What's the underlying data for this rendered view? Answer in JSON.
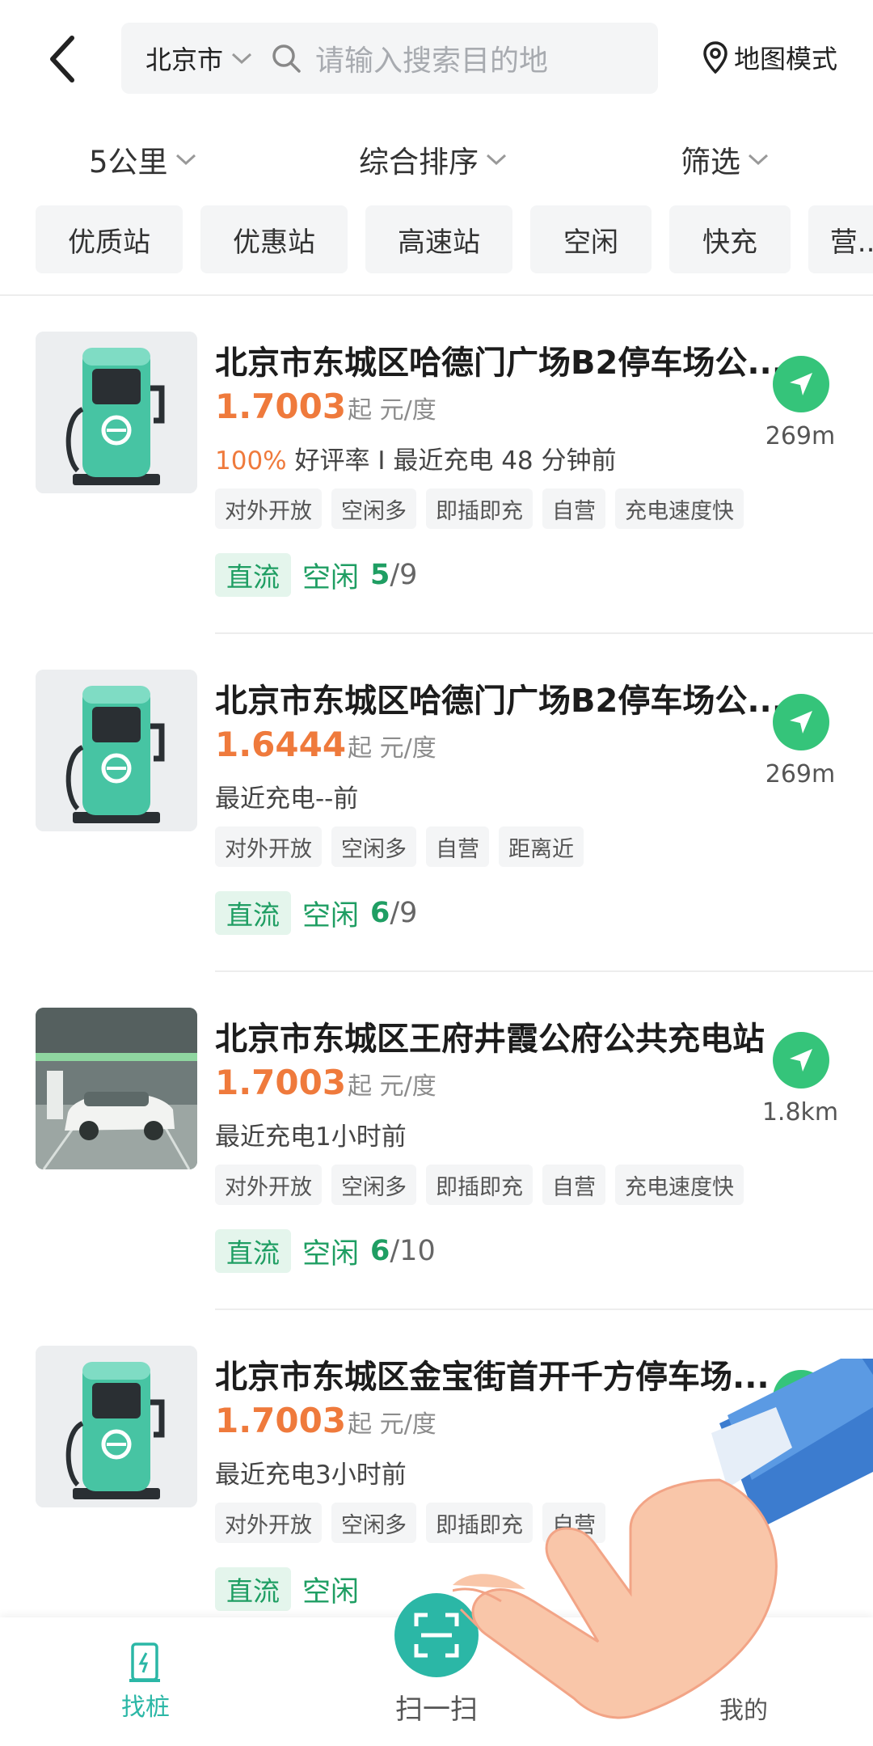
{
  "header": {
    "city": "北京市",
    "search_placeholder": "请输入搜索目的地",
    "map_mode": "地图模式"
  },
  "sortbar": {
    "distance": "5公里",
    "sort": "综合排序",
    "filter": "筛选"
  },
  "chips": [
    "优质站",
    "优惠站",
    "高速站",
    "空闲",
    "快充",
    "营..."
  ],
  "stations": [
    {
      "title": "北京市东城区哈德门广场B2停车场公...",
      "price": "1.7003",
      "price_unit": "起 元/度",
      "rating": "100%",
      "meta": "好评率 I 最近充电 48 分钟前",
      "tags": [
        "对外开放",
        "空闲多",
        "即插即充",
        "自营",
        "充电速度快"
      ],
      "type": "直流",
      "idle_label": "空闲",
      "available": "5",
      "total": "9",
      "distance": "269m",
      "thumb": "charger-icon"
    },
    {
      "title": "北京市东城区哈德门广场B2停车场公...",
      "price": "1.6444",
      "price_unit": "起 元/度",
      "rating": "",
      "meta": "最近充电--前",
      "tags": [
        "对外开放",
        "空闲多",
        "自营",
        "距离近"
      ],
      "type": "直流",
      "idle_label": "空闲",
      "available": "6",
      "total": "9",
      "distance": "269m",
      "thumb": "charger-icon"
    },
    {
      "title": "北京市东城区王府井霞公府公共充电站",
      "price": "1.7003",
      "price_unit": "起 元/度",
      "rating": "",
      "meta": "最近充电1小时前",
      "tags": [
        "对外开放",
        "空闲多",
        "即插即充",
        "自营",
        "充电速度快"
      ],
      "type": "直流",
      "idle_label": "空闲",
      "available": "6",
      "total": "10",
      "distance": "1.8km",
      "thumb": "parking-photo"
    },
    {
      "title": "北京市东城区金宝街首开千方停车场...",
      "price": "1.7003",
      "price_unit": "起 元/度",
      "rating": "",
      "meta": "最近充电3小时前",
      "tags": [
        "对外开放",
        "空闲多",
        "即插即充",
        "自营"
      ],
      "type": "直流",
      "idle_label": "空闲",
      "available": "",
      "total": "",
      "distance": "",
      "thumb": "charger-icon"
    }
  ],
  "bottombar": {
    "find": "找桩",
    "scan": "扫一扫",
    "mine": "我的"
  },
  "colors": {
    "accent_green": "#35c47a",
    "price_orange": "#ef7a3c",
    "teal": "#2bb7a6"
  }
}
